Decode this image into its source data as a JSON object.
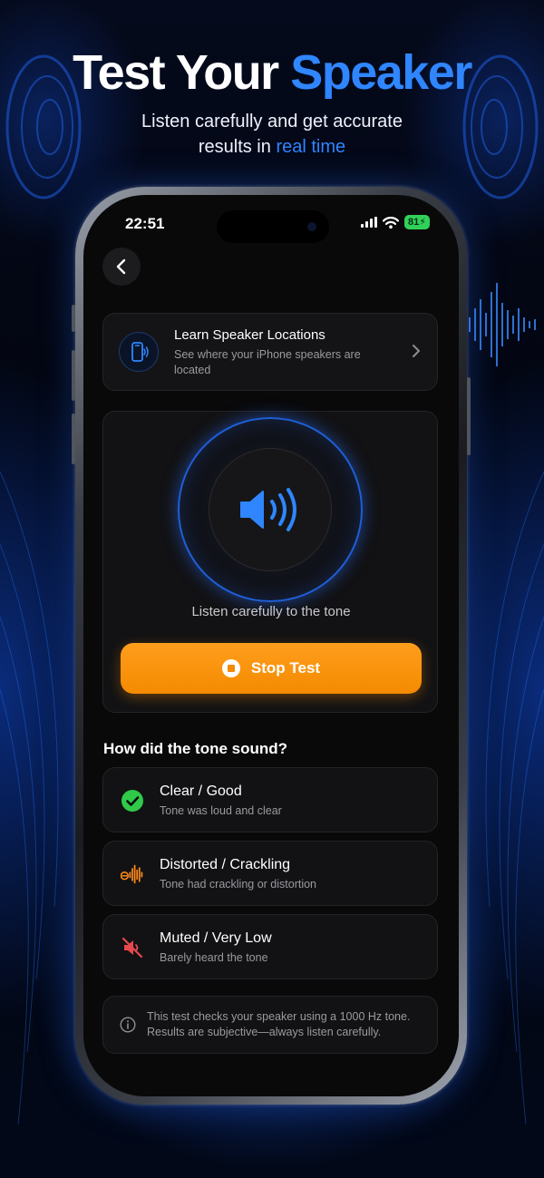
{
  "header": {
    "title_main": "Test Your",
    "title_accent": "Speaker",
    "subtitle_line1": "Listen carefully and get accurate",
    "subtitle_line2_prefix": "results in",
    "subtitle_line2_accent": "real time"
  },
  "status_bar": {
    "time": "22:51",
    "battery": "81"
  },
  "speaker_locations": {
    "title": "Learn Speaker Locations",
    "description": "See where your iPhone speakers are located"
  },
  "tone_test": {
    "instruction": "Listen carefully to the tone",
    "stop_label": "Stop Test"
  },
  "feedback": {
    "question": "How did the tone sound?",
    "options": [
      {
        "title": "Clear / Good",
        "description": "Tone was loud and clear",
        "icon": "check-circle-icon",
        "color": "#30c94a"
      },
      {
        "title": "Distorted / Crackling",
        "description": "Tone had crackling or distortion",
        "icon": "waveform-icon",
        "color": "#ff8a1c"
      },
      {
        "title": "Muted / Very Low",
        "description": "Barely heard the tone",
        "icon": "speaker-muted-icon",
        "color": "#e5484d"
      }
    ]
  },
  "info_note": "This test checks your speaker using a 1000 Hz tone. Results are subjective—always listen carefully.",
  "colors": {
    "accent_blue": "#2f86ff",
    "stop_orange": "#f48a00",
    "card_bg": "#141416"
  }
}
